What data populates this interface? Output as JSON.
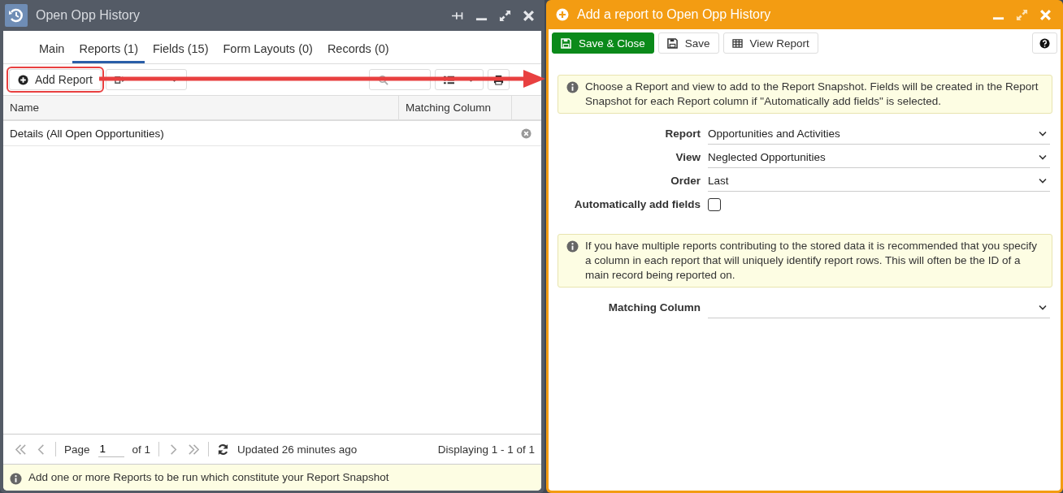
{
  "left_window": {
    "title": "Open Opp History",
    "tabs": [
      {
        "label": "Main",
        "selected": false
      },
      {
        "label": "Reports (1)",
        "selected": true
      },
      {
        "label": "Fields (15)",
        "selected": false
      },
      {
        "label": "Form Layouts (0)",
        "selected": false
      },
      {
        "label": "Records (0)",
        "selected": false
      }
    ],
    "toolbar": {
      "add_report": "Add Report"
    },
    "table": {
      "columns": [
        "Name",
        "Matching Column"
      ],
      "rows": [
        {
          "name": "Details (All Open Opportunities)"
        }
      ]
    },
    "pager": {
      "page_label": "Page",
      "page": "1",
      "of": "of 1",
      "updated": "Updated 26 minutes ago",
      "displaying": "Displaying 1 - 1 of 1"
    },
    "info": "Add one or more Reports to be run which constitute your Report Snapshot"
  },
  "dialog": {
    "title": "Add a report to Open Opp History",
    "buttons": {
      "save_close": "Save & Close",
      "save": "Save",
      "view_report": "View Report"
    },
    "info": "Choose a Report and view to add to the Report Snapshot. Fields will be created in the Report Snapshot for each Report column if \"Automatically add fields\" is selected.",
    "fields": [
      {
        "kind": "select",
        "label": "Report",
        "value": "Opportunities and Activities"
      },
      {
        "kind": "select",
        "label": "View",
        "value": "Neglected Opportunities"
      },
      {
        "kind": "select",
        "label": "Order",
        "value": "Last"
      },
      {
        "kind": "checkbox",
        "label": "Automatically add fields",
        "checked": false
      }
    ],
    "note": "If you have multiple reports contributing to the stored data it is recommended that you specify a column in each report that will uniquely identify report rows. This will often be the ID of a main record being reported on.",
    "matching_field": {
      "kind": "select",
      "label": "Matching Column"
    }
  }
}
